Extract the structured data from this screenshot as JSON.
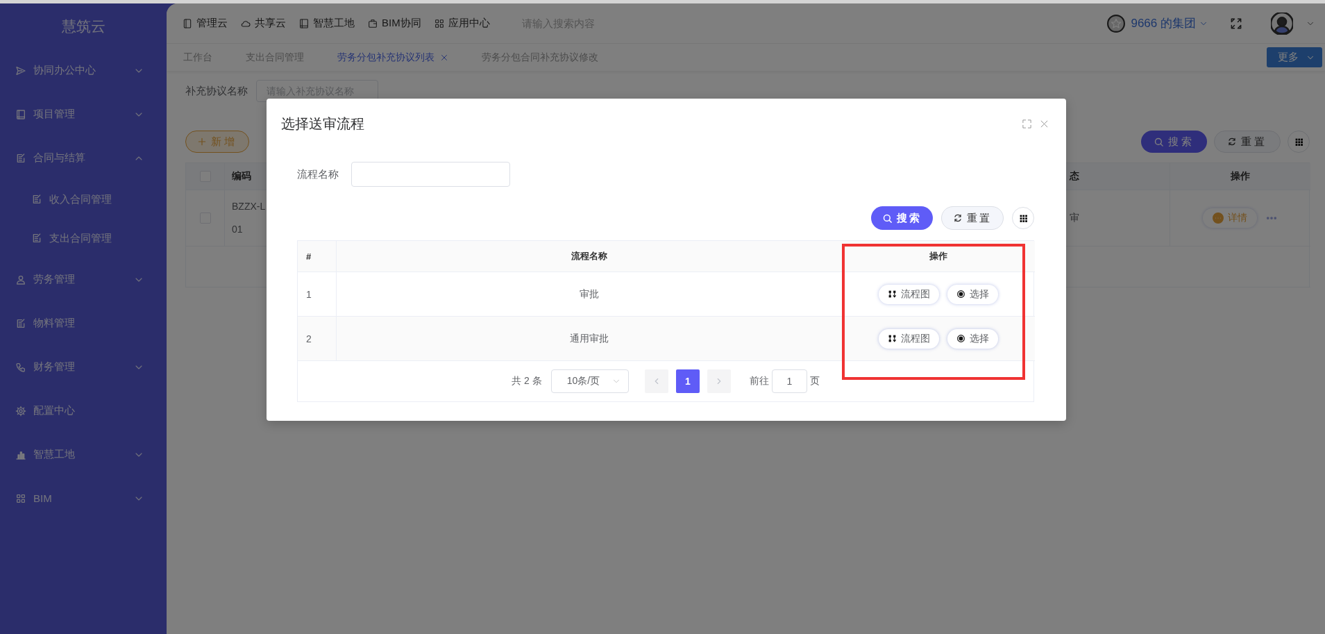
{
  "sidebar": {
    "logo": "慧筑云",
    "items": [
      {
        "label": "协同办公中心",
        "kind": "group",
        "expanded": false
      },
      {
        "label": "项目管理",
        "kind": "group",
        "expanded": false
      },
      {
        "label": "合同与结算",
        "kind": "group",
        "expanded": true,
        "children": [
          {
            "label": "收入合同管理"
          },
          {
            "label": "支出合同管理"
          }
        ]
      },
      {
        "label": "劳务管理",
        "kind": "group",
        "expanded": false
      },
      {
        "label": "物料管理",
        "kind": "link"
      },
      {
        "label": "财务管理",
        "kind": "group",
        "expanded": false
      },
      {
        "label": "配置中心",
        "kind": "link"
      },
      {
        "label": "智慧工地",
        "kind": "group",
        "expanded": false
      },
      {
        "label": "BIM",
        "kind": "group",
        "expanded": false
      }
    ]
  },
  "header": {
    "nav": [
      "管理云",
      "共享云",
      "智慧工地",
      "BIM协同",
      "应用中心"
    ],
    "search": {
      "placeholder": "请输入搜索内容"
    },
    "org": "9666 的集团"
  },
  "tabs": [
    {
      "label": "工作台",
      "selected": false,
      "closable": false
    },
    {
      "label": "支出合同管理",
      "selected": false,
      "closable": false
    },
    {
      "label": "劳务分包补充协议列表",
      "selected": true,
      "closable": true
    },
    {
      "label": "劳务分包合同补充协议修改",
      "selected": false,
      "closable": false
    }
  ],
  "more_button": "更多",
  "page": {
    "filter": {
      "label": "补充协议名称",
      "placeholder": "请输入补充协议名称"
    },
    "add_button": "新增",
    "search_button": "搜索",
    "reset_button": "重置",
    "table": {
      "select_all_checked": false,
      "columns": [
        "编码",
        "态",
        "操作"
      ],
      "rows": [
        {
          "checked": false,
          "code": [
            "BZZX-L",
            "01"
          ],
          "status": "审",
          "actions": [
            "详情"
          ]
        }
      ]
    }
  },
  "dialog": {
    "title": "选择送审流程",
    "filter": {
      "label": "流程名称"
    },
    "search_button": "搜索",
    "reset_button": "重置",
    "table": {
      "columns": [
        {
          "label": "#",
          "highlighted": false
        },
        {
          "label": "流程名称",
          "highlighted": false
        },
        {
          "label": "操作",
          "highlighted": true
        }
      ],
      "rows": [
        {
          "index": "1",
          "name": "审批",
          "actions": [
            "流程图",
            "选择"
          ]
        },
        {
          "index": "2",
          "name": "通用审批",
          "actions": [
            "流程图",
            "选择"
          ]
        }
      ]
    },
    "pagination": {
      "total": "共 2 条",
      "page_size": "10条/页",
      "pages": [
        {
          "label": "1",
          "selected": true
        }
      ],
      "goto_label": "前往",
      "goto_value": "1",
      "goto_suffix": "页"
    }
  }
}
